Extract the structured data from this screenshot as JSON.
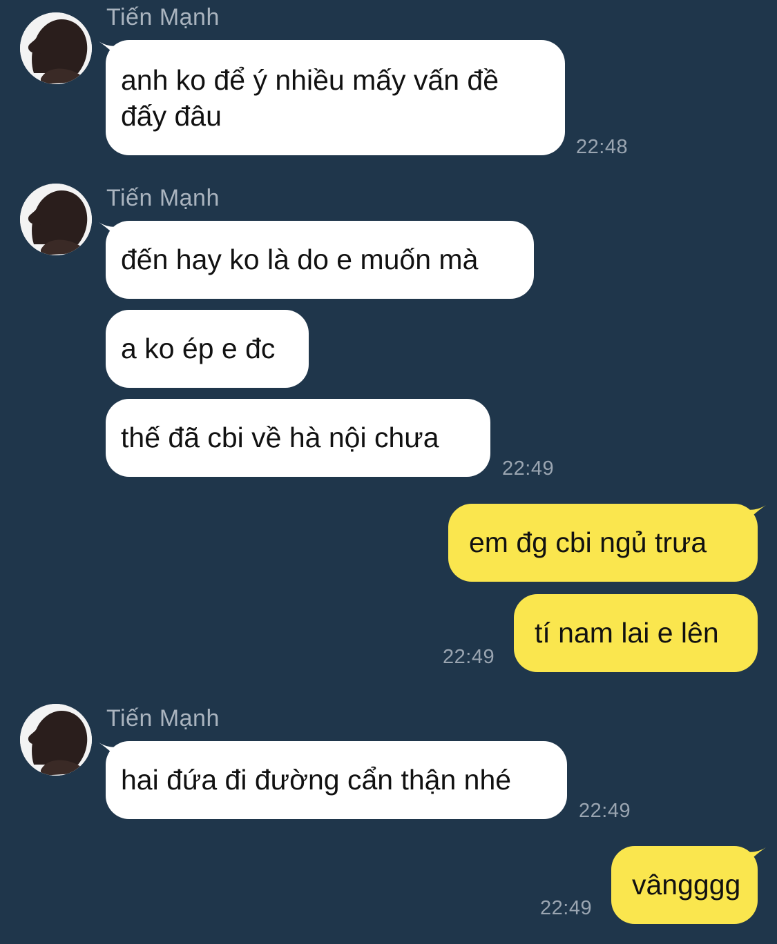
{
  "colors": {
    "background": "#1f364b",
    "incoming_bubble": "#ffffff",
    "outgoing_bubble": "#fae64e",
    "meta_text": "#9aa5b1",
    "sender_name": "#aab4bf"
  },
  "conversation": {
    "groups": [
      {
        "sender": "Tiến Mạnh",
        "avatar_icon": "profile-silhouette-icon",
        "messages": [
          "anh ko để ý nhiều mấy vấn đề\nđấy đâu"
        ],
        "time": "22:48"
      },
      {
        "sender": "Tiến Mạnh",
        "avatar_icon": "profile-silhouette-icon",
        "messages": [
          "đến hay ko là do e muốn mà",
          "a ko ép e đc",
          "thế đã cbi về hà nội chưa"
        ],
        "time": "22:49"
      },
      {
        "sender": "me",
        "messages": [
          "em đg cbi ngủ trưa",
          "tí nam lai e lên"
        ],
        "time": "22:49"
      },
      {
        "sender": "Tiến Mạnh",
        "avatar_icon": "profile-silhouette-icon",
        "messages": [
          "hai đứa đi đường cẩn thận nhé"
        ],
        "time": "22:49"
      },
      {
        "sender": "me",
        "messages": [
          "vângggg"
        ],
        "time": "22:49"
      }
    ]
  }
}
